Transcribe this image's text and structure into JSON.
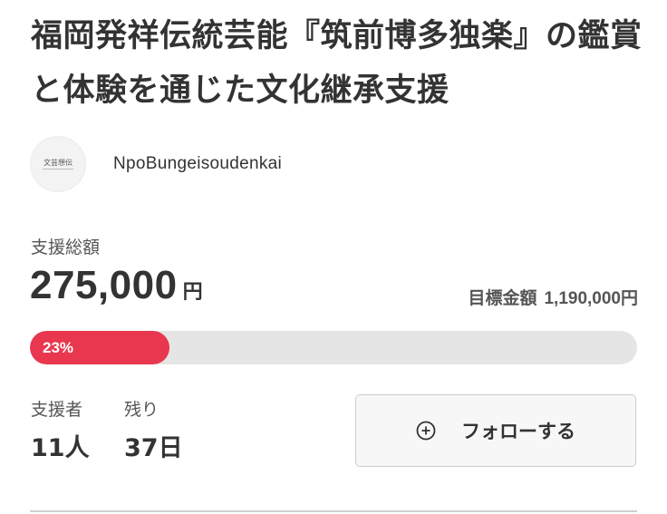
{
  "project": {
    "title": "福岡発祥伝統芸能『筑前博多独楽』の鑑賞と体験を通じた文化継承支援"
  },
  "owner": {
    "avatar_text": "文芸想伝",
    "name": "NpoBungeisoudenkai"
  },
  "funding": {
    "total_label": "支援総額",
    "total_amount": "275,000",
    "currency_unit": "円",
    "goal_label": "目標金額",
    "goal_amount": "1,190,000円",
    "progress_percent_label": "23%",
    "progress_fraction": 0.23,
    "accent_color": "#e8374f"
  },
  "stats": {
    "supporters_label": "支援者",
    "supporters_value": "11人",
    "remaining_label": "残り",
    "remaining_value": "37日"
  },
  "follow": {
    "icon": "plus-circle-icon",
    "label": "フォローする"
  }
}
